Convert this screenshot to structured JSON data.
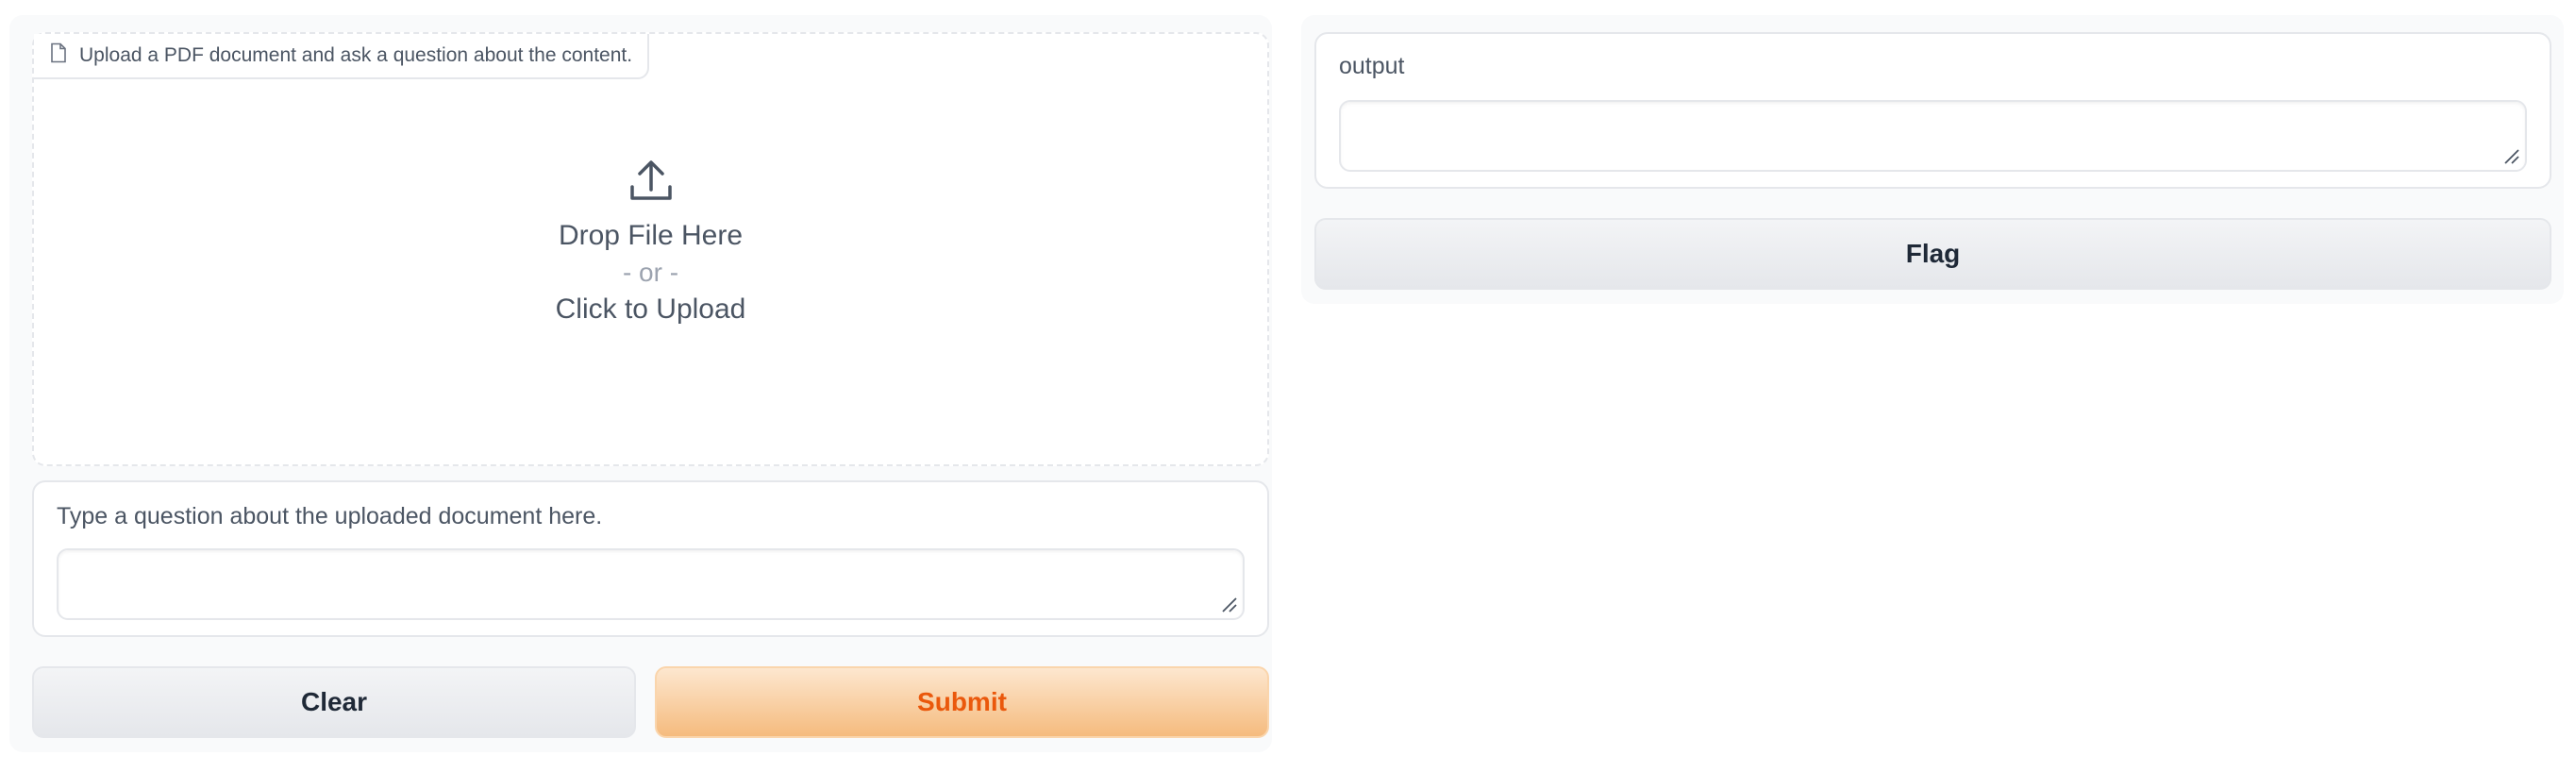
{
  "upload": {
    "label": "Upload a PDF document and ask a question about the content.",
    "drop_text": "Drop File Here",
    "or_text": "- or -",
    "click_text": "Click to Upload",
    "file_icon": "file-icon",
    "upload_icon": "upload-icon"
  },
  "question": {
    "label": "Type a question about the uploaded document here.",
    "value": ""
  },
  "output": {
    "label": "output",
    "value": ""
  },
  "buttons": {
    "clear_label": "Clear",
    "submit_label": "Submit",
    "flag_label": "Flag"
  },
  "colors": {
    "primary_text": "#ea580c",
    "primary_gradient_top": "#fde7cf",
    "primary_gradient_bottom": "#f5bb7e",
    "panel_bg": "#f9fafb"
  }
}
